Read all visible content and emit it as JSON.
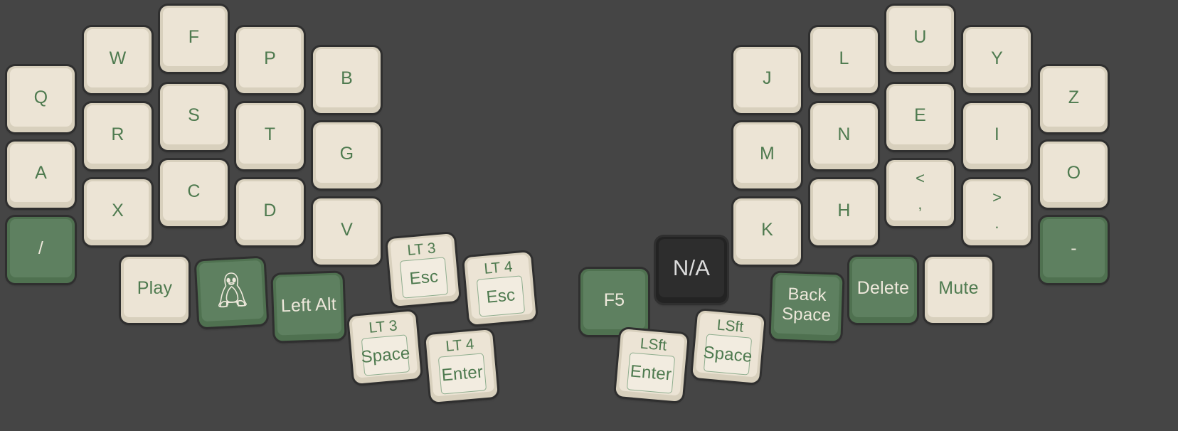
{
  "meta": {
    "title": "Split ergonomic keyboard layout",
    "background_color": "#454545",
    "keycap_color": "#ece4d5",
    "keycap_bezel_color": "#d8d0bd",
    "accent_green": "#5e8060",
    "legend_green": "#4e7a4f",
    "dark_key_color": "#2d2d2d",
    "dark_key_text": "#dcdcdc"
  },
  "left_half": {
    "name": "left-half",
    "columns": [
      {
        "name": "pinky-outer-column",
        "keys": [
          {
            "id": "key-q",
            "label": "Q",
            "style": "light"
          },
          {
            "id": "key-a",
            "label": "A",
            "style": "light"
          },
          {
            "id": "key-slash",
            "label": "/",
            "style": "green"
          }
        ]
      },
      {
        "name": "ring-column",
        "keys": [
          {
            "id": "key-w",
            "label": "W",
            "style": "light"
          },
          {
            "id": "key-r",
            "label": "R",
            "style": "light"
          },
          {
            "id": "key-x",
            "label": "X",
            "style": "light"
          }
        ]
      },
      {
        "name": "middle-column",
        "keys": [
          {
            "id": "key-f",
            "label": "F",
            "style": "light"
          },
          {
            "id": "key-s",
            "label": "S",
            "style": "light"
          },
          {
            "id": "key-c",
            "label": "C",
            "style": "light"
          }
        ]
      },
      {
        "name": "index-column",
        "keys": [
          {
            "id": "key-p",
            "label": "P",
            "style": "light"
          },
          {
            "id": "key-t",
            "label": "T",
            "style": "light"
          },
          {
            "id": "key-d",
            "label": "D",
            "style": "light"
          }
        ]
      },
      {
        "name": "index-inner-column",
        "keys": [
          {
            "id": "key-b",
            "label": "B",
            "style": "light"
          },
          {
            "id": "key-g",
            "label": "G",
            "style": "light"
          },
          {
            "id": "key-v",
            "label": "V",
            "style": "light"
          }
        ]
      }
    ],
    "thumb_keys": [
      {
        "id": "key-play",
        "label": "Play",
        "style": "light"
      },
      {
        "id": "key-linux",
        "label": "",
        "style": "green",
        "icon": "linux-tux-icon"
      },
      {
        "id": "key-left-alt",
        "label": "Left Alt",
        "style": "green"
      },
      {
        "id": "key-lt3-esc",
        "top_label": "LT 3",
        "label": "Esc",
        "style": "layer-tap"
      },
      {
        "id": "key-lt4-esc",
        "top_label": "LT 4",
        "label": "Esc",
        "style": "layer-tap"
      },
      {
        "id": "key-lt3-space",
        "top_label": "LT 3",
        "label": "Space",
        "style": "layer-tap"
      },
      {
        "id": "key-lt4-enter",
        "top_label": "LT 4",
        "label": "Enter",
        "style": "layer-tap"
      }
    ]
  },
  "right_half": {
    "name": "right-half",
    "columns": [
      {
        "name": "index-inner-column",
        "keys": [
          {
            "id": "key-j",
            "label": "J",
            "style": "light"
          },
          {
            "id": "key-m",
            "label": "M",
            "style": "light"
          },
          {
            "id": "key-k",
            "label": "K",
            "style": "light"
          }
        ]
      },
      {
        "name": "index-column",
        "keys": [
          {
            "id": "key-l",
            "label": "L",
            "style": "light"
          },
          {
            "id": "key-n",
            "label": "N",
            "style": "light"
          },
          {
            "id": "key-h",
            "label": "H",
            "style": "light"
          }
        ]
      },
      {
        "name": "middle-column",
        "keys": [
          {
            "id": "key-u",
            "label": "U",
            "style": "light"
          },
          {
            "id": "key-e",
            "label": "E",
            "style": "light"
          },
          {
            "id": "key-comma",
            "label": "< ,",
            "style": "light",
            "glyph_top": "<",
            "glyph_bottom": ","
          }
        ]
      },
      {
        "name": "ring-column",
        "keys": [
          {
            "id": "key-y",
            "label": "Y",
            "style": "light"
          },
          {
            "id": "key-i",
            "label": "I",
            "style": "light"
          },
          {
            "id": "key-period",
            "label": "> .",
            "style": "light",
            "glyph_top": ">",
            "glyph_bottom": "."
          }
        ]
      },
      {
        "name": "pinky-outer-column",
        "keys": [
          {
            "id": "key-z",
            "label": "Z",
            "style": "light"
          },
          {
            "id": "key-o",
            "label": "O",
            "style": "light"
          },
          {
            "id": "key-minus",
            "label": "-",
            "style": "green"
          }
        ]
      }
    ],
    "thumb_keys": [
      {
        "id": "key-f5",
        "label": "F5",
        "style": "green"
      },
      {
        "id": "key-na",
        "label": "N/A",
        "style": "dark"
      },
      {
        "id": "key-lsft-enter",
        "top_label": "LSft",
        "label": "Enter",
        "style": "layer-tap"
      },
      {
        "id": "key-lsft-space",
        "top_label": "LSft",
        "label": "Space",
        "style": "layer-tap"
      },
      {
        "id": "key-backspace",
        "label": "Back\nSpace",
        "style": "green"
      },
      {
        "id": "key-delete",
        "label": "Delete",
        "style": "green"
      },
      {
        "id": "key-mute",
        "label": "Mute",
        "style": "light"
      }
    ]
  }
}
